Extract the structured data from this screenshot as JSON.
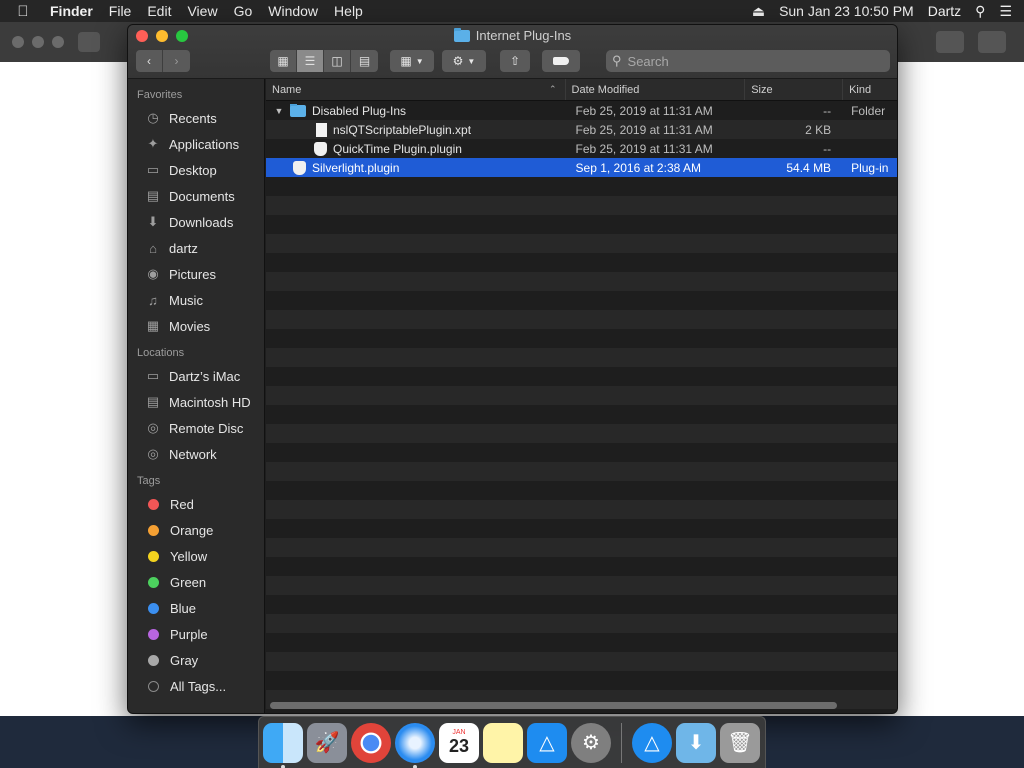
{
  "menubar": {
    "app_name": "Finder",
    "menus": [
      "File",
      "Edit",
      "View",
      "Go",
      "Window",
      "Help"
    ],
    "datetime": "Sun Jan 23  10:50 PM",
    "user": "Dartz"
  },
  "window": {
    "title": "Internet Plug-Ins",
    "search_placeholder": "Search"
  },
  "sidebar": {
    "favorites_header": "Favorites",
    "favorites": [
      {
        "label": "Recents",
        "icon": "clock-icon"
      },
      {
        "label": "Applications",
        "icon": "applications-icon"
      },
      {
        "label": "Desktop",
        "icon": "desktop-icon"
      },
      {
        "label": "Documents",
        "icon": "document-icon"
      },
      {
        "label": "Downloads",
        "icon": "download-icon"
      },
      {
        "label": "dartz",
        "icon": "home-icon"
      },
      {
        "label": "Pictures",
        "icon": "camera-icon"
      },
      {
        "label": "Music",
        "icon": "music-icon"
      },
      {
        "label": "Movies",
        "icon": "film-icon"
      }
    ],
    "locations_header": "Locations",
    "locations": [
      {
        "label": "Dartz’s iMac",
        "icon": "computer-icon"
      },
      {
        "label": "Macintosh HD",
        "icon": "hard-disk-icon"
      },
      {
        "label": "Remote Disc",
        "icon": "disc-icon"
      },
      {
        "label": "Network",
        "icon": "globe-icon"
      }
    ],
    "tags_header": "Tags",
    "tags": [
      {
        "label": "Red",
        "color": "#f25656"
      },
      {
        "label": "Orange",
        "color": "#f5a033"
      },
      {
        "label": "Yellow",
        "color": "#f3d31f"
      },
      {
        "label": "Green",
        "color": "#4cd15e"
      },
      {
        "label": "Blue",
        "color": "#3b8ff0"
      },
      {
        "label": "Purple",
        "color": "#b865e0"
      },
      {
        "label": "Gray",
        "color": "#a8a8a8"
      }
    ],
    "all_tags": "All Tags..."
  },
  "columns": {
    "name": "Name",
    "date": "Date Modified",
    "size": "Size",
    "kind": "Kind"
  },
  "rows": [
    {
      "name": "Disabled Plug-Ins",
      "date": "Feb 25, 2019 at 11:31 AM",
      "size": "--",
      "kind": "Folder"
    },
    {
      "name": "nslQTScriptablePlugin.xpt",
      "date": "Feb 25, 2019 at 11:31 AM",
      "size": "2 KB",
      "kind": ""
    },
    {
      "name": "QuickTime Plugin.plugin",
      "date": "Feb 25, 2019 at 11:31 AM",
      "size": "--",
      "kind": ""
    },
    {
      "name": "Silverlight.plugin",
      "date": "Sep 1, 2016 at 2:38 AM",
      "size": "54.4 MB",
      "kind": "Plug-in"
    }
  ],
  "dock": {
    "calendar_month": "JAN",
    "calendar_day": "23"
  },
  "colors": {
    "selection": "#1f5cd6",
    "close": "#ff5f57",
    "minimize": "#febc2e",
    "maximize": "#28c840"
  }
}
